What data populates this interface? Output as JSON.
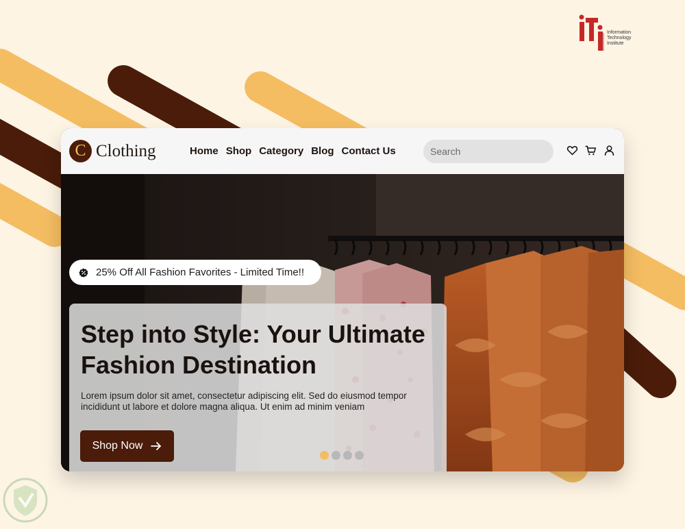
{
  "brand": {
    "initial": "C",
    "name": "Clothing"
  },
  "nav": {
    "links": [
      "Home",
      "Shop",
      "Category",
      "Blog",
      "Contact Us"
    ]
  },
  "search": {
    "placeholder": "Search"
  },
  "promo": {
    "text": "25% Off All Fashion Favorites - Limited Time!!"
  },
  "hero": {
    "title": "Step into Style: Your Ultimate Fashion Destination",
    "description": "Lorem ipsum dolor sit amet, consectetur adipiscing elit. Sed do eiusmod tempor incididunt ut labore et dolore magna aliqua. Ut enim ad minim veniam",
    "cta_label": "Shop Now"
  },
  "carousel": {
    "slide_count": 4,
    "active_index": 0
  },
  "watermark": {
    "org_lines": [
      "Information",
      "Technology",
      "Institute"
    ]
  },
  "colors": {
    "accent": "#4a1c09",
    "gold": "#f4bd62",
    "background": "#fdf4e4"
  }
}
